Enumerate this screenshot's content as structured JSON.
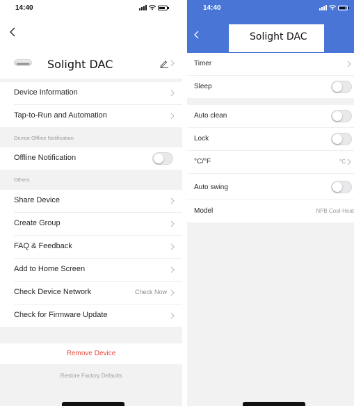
{
  "left": {
    "status": {
      "time": "14:40"
    },
    "device_name": "Solight DAC",
    "rows": [
      {
        "label": "Device Information"
      },
      {
        "label": "Tap-to-Run and Automation"
      }
    ],
    "sections": {
      "offline": "Device Offline Notification",
      "others": "Others"
    },
    "offline_notification": {
      "label": "Offline Notification",
      "enabled": false
    },
    "other_rows": [
      {
        "label": "Share Device"
      },
      {
        "label": "Create Group"
      },
      {
        "label": "FAQ & Feedback"
      },
      {
        "label": "Add to Home Screen"
      },
      {
        "label": "Check Device Network",
        "extra": "Check Now"
      },
      {
        "label": "Check for Firmware Update"
      }
    ],
    "remove_device": "Remove Device",
    "restore_defaults": "Restore Factory Defaults"
  },
  "right": {
    "status": {
      "time": "14:40"
    },
    "title": "Solight DAC",
    "rows": {
      "timer": {
        "label": "Timer"
      },
      "sleep": {
        "label": "Sleep",
        "enabled": false
      },
      "auto_clean": {
        "label": "Auto clean",
        "enabled": false
      },
      "lock": {
        "label": "Lock",
        "enabled": false
      },
      "temp_unit": {
        "label": "°C/°F",
        "value": "°C"
      },
      "auto_swing": {
        "label": "Auto swing",
        "enabled": false
      },
      "model": {
        "label": "Model",
        "value": "NPB Cool-Heat"
      }
    }
  },
  "colors": {
    "accent_blue": "#4875d6",
    "danger_red": "#e5453a",
    "section_bg": "#f2f2f2"
  }
}
